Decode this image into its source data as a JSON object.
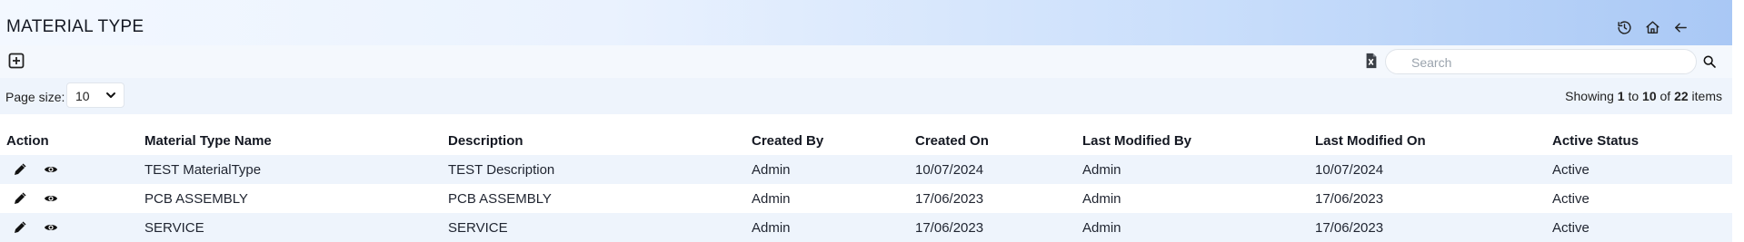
{
  "header": {
    "title": "MATERIAL TYPE",
    "icons": [
      "history-icon",
      "home-icon",
      "back-arrow-icon"
    ]
  },
  "toolbar": {
    "search_placeholder": "Search",
    "search_value": ""
  },
  "pager": {
    "page_size_label": "Page size:",
    "page_size_value": "10",
    "showing_prefix": "Showing",
    "from": "1",
    "to_word": "to",
    "to": "10",
    "of_word": "of",
    "total": "22",
    "items_word": "items"
  },
  "table": {
    "columns": [
      "Action",
      "Material Type Name",
      "Description",
      "Created By",
      "Created On",
      "Last Modified By",
      "Last Modified On",
      "Active Status"
    ],
    "rows": [
      [
        "TEST MaterialType",
        "TEST Description",
        "Admin",
        "10/07/2024",
        "Admin",
        "10/07/2024",
        "Active"
      ],
      [
        "PCB ASSEMBLY",
        "PCB ASSEMBLY",
        "Admin",
        "17/06/2023",
        "Admin",
        "17/06/2023",
        "Active"
      ],
      [
        "SERVICE",
        "SERVICE",
        "Admin",
        "17/06/2023",
        "Admin",
        "17/06/2023",
        "Active"
      ]
    ]
  },
  "colors": {
    "header_gradient_end": "#a9c8f5",
    "row_alt": "#eef4fc",
    "excel_green": "#1d6f42"
  }
}
